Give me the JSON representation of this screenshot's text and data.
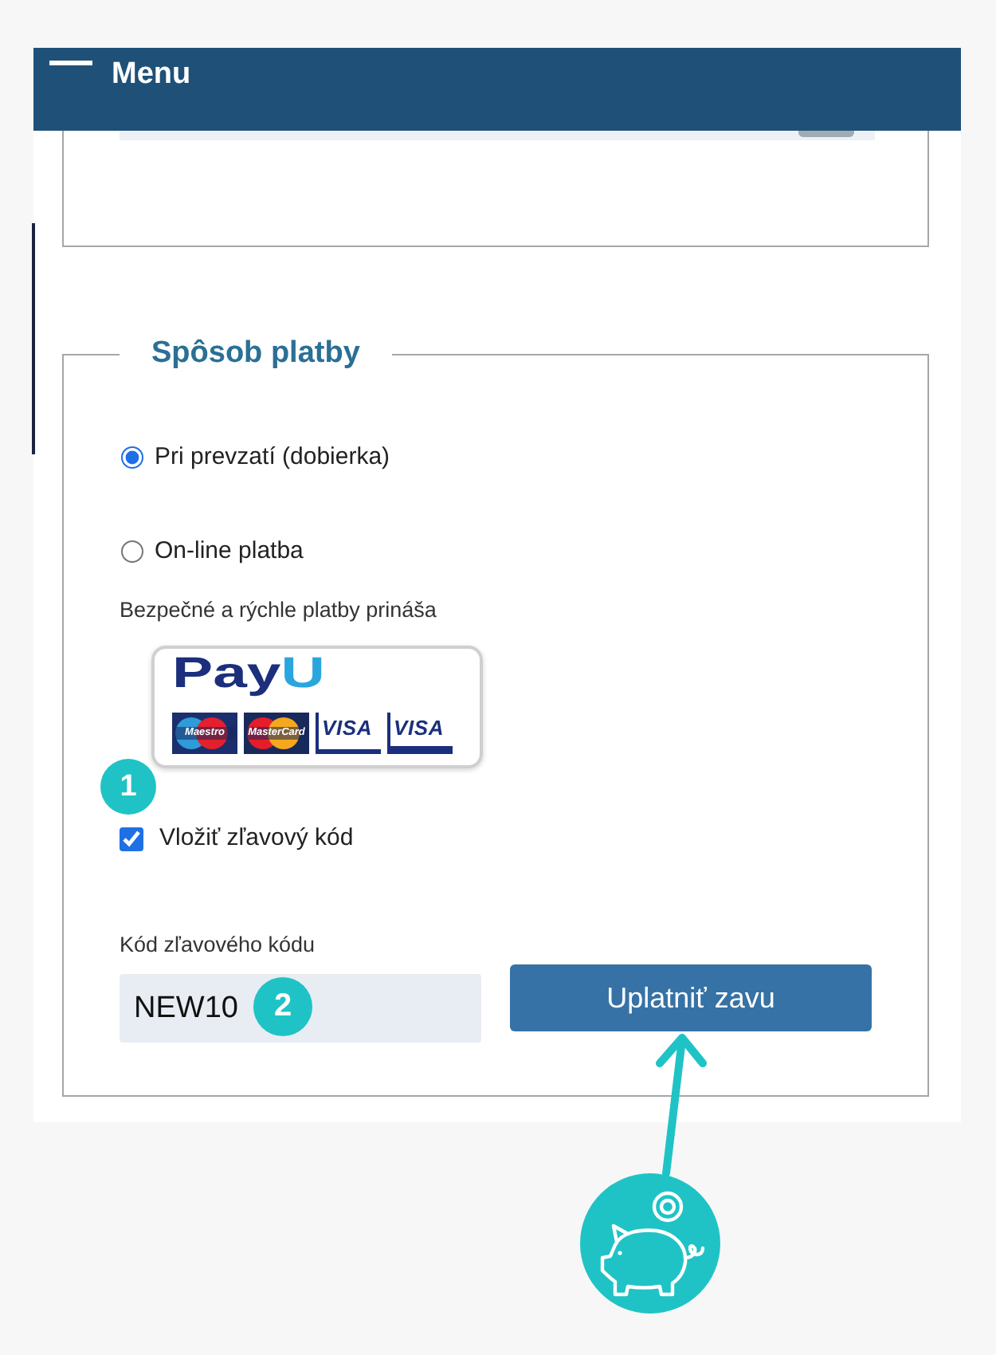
{
  "header": {
    "title": "Menu"
  },
  "payment": {
    "legend": "Spôsob platby",
    "options": [
      {
        "label": "Pri prevzatí (dobierka)",
        "selected": true
      },
      {
        "label": "On-line platba",
        "selected": false
      }
    ],
    "provider_note": "Bezpečné a rýchle platby prináša",
    "provider_logo": {
      "brand_main": "Pay",
      "brand_accent": "U",
      "cards": [
        {
          "kind": "maestro",
          "label": "Maestro"
        },
        {
          "kind": "mastercard",
          "label": "MasterCard"
        },
        {
          "kind": "visa",
          "label": "VISA"
        },
        {
          "kind": "visa_electron",
          "label": "VISA"
        }
      ]
    },
    "discount_toggle": {
      "label": "Vložiť zľavový kód",
      "checked": true,
      "badge": "1"
    },
    "discount_code": {
      "label": "Kód zľavového kódu",
      "value": "NEW10",
      "badge": "2"
    },
    "apply_button": {
      "label": "Uplatniť zavu"
    }
  }
}
